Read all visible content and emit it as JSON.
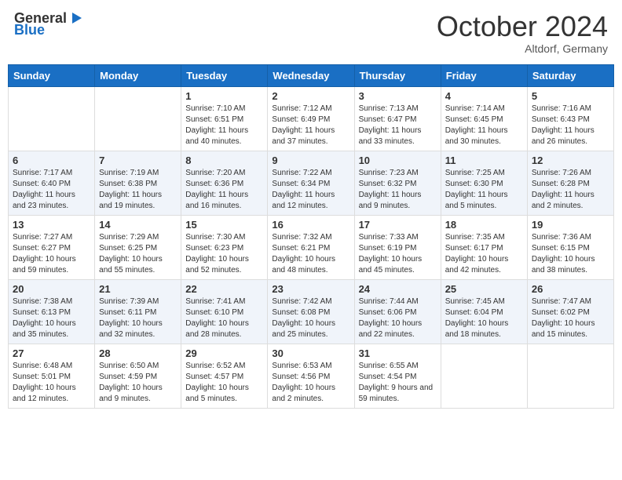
{
  "header": {
    "logo_general": "General",
    "logo_blue": "Blue",
    "month": "October 2024",
    "location": "Altdorf, Germany"
  },
  "weekdays": [
    "Sunday",
    "Monday",
    "Tuesday",
    "Wednesday",
    "Thursday",
    "Friday",
    "Saturday"
  ],
  "weeks": [
    [
      {
        "day": "",
        "sunrise": "",
        "sunset": "",
        "daylight": ""
      },
      {
        "day": "",
        "sunrise": "",
        "sunset": "",
        "daylight": ""
      },
      {
        "day": "1",
        "sunrise": "Sunrise: 7:10 AM",
        "sunset": "Sunset: 6:51 PM",
        "daylight": "Daylight: 11 hours and 40 minutes."
      },
      {
        "day": "2",
        "sunrise": "Sunrise: 7:12 AM",
        "sunset": "Sunset: 6:49 PM",
        "daylight": "Daylight: 11 hours and 37 minutes."
      },
      {
        "day": "3",
        "sunrise": "Sunrise: 7:13 AM",
        "sunset": "Sunset: 6:47 PM",
        "daylight": "Daylight: 11 hours and 33 minutes."
      },
      {
        "day": "4",
        "sunrise": "Sunrise: 7:14 AM",
        "sunset": "Sunset: 6:45 PM",
        "daylight": "Daylight: 11 hours and 30 minutes."
      },
      {
        "day": "5",
        "sunrise": "Sunrise: 7:16 AM",
        "sunset": "Sunset: 6:43 PM",
        "daylight": "Daylight: 11 hours and 26 minutes."
      }
    ],
    [
      {
        "day": "6",
        "sunrise": "Sunrise: 7:17 AM",
        "sunset": "Sunset: 6:40 PM",
        "daylight": "Daylight: 11 hours and 23 minutes."
      },
      {
        "day": "7",
        "sunrise": "Sunrise: 7:19 AM",
        "sunset": "Sunset: 6:38 PM",
        "daylight": "Daylight: 11 hours and 19 minutes."
      },
      {
        "day": "8",
        "sunrise": "Sunrise: 7:20 AM",
        "sunset": "Sunset: 6:36 PM",
        "daylight": "Daylight: 11 hours and 16 minutes."
      },
      {
        "day": "9",
        "sunrise": "Sunrise: 7:22 AM",
        "sunset": "Sunset: 6:34 PM",
        "daylight": "Daylight: 11 hours and 12 minutes."
      },
      {
        "day": "10",
        "sunrise": "Sunrise: 7:23 AM",
        "sunset": "Sunset: 6:32 PM",
        "daylight": "Daylight: 11 hours and 9 minutes."
      },
      {
        "day": "11",
        "sunrise": "Sunrise: 7:25 AM",
        "sunset": "Sunset: 6:30 PM",
        "daylight": "Daylight: 11 hours and 5 minutes."
      },
      {
        "day": "12",
        "sunrise": "Sunrise: 7:26 AM",
        "sunset": "Sunset: 6:28 PM",
        "daylight": "Daylight: 11 hours and 2 minutes."
      }
    ],
    [
      {
        "day": "13",
        "sunrise": "Sunrise: 7:27 AM",
        "sunset": "Sunset: 6:27 PM",
        "daylight": "Daylight: 10 hours and 59 minutes."
      },
      {
        "day": "14",
        "sunrise": "Sunrise: 7:29 AM",
        "sunset": "Sunset: 6:25 PM",
        "daylight": "Daylight: 10 hours and 55 minutes."
      },
      {
        "day": "15",
        "sunrise": "Sunrise: 7:30 AM",
        "sunset": "Sunset: 6:23 PM",
        "daylight": "Daylight: 10 hours and 52 minutes."
      },
      {
        "day": "16",
        "sunrise": "Sunrise: 7:32 AM",
        "sunset": "Sunset: 6:21 PM",
        "daylight": "Daylight: 10 hours and 48 minutes."
      },
      {
        "day": "17",
        "sunrise": "Sunrise: 7:33 AM",
        "sunset": "Sunset: 6:19 PM",
        "daylight": "Daylight: 10 hours and 45 minutes."
      },
      {
        "day": "18",
        "sunrise": "Sunrise: 7:35 AM",
        "sunset": "Sunset: 6:17 PM",
        "daylight": "Daylight: 10 hours and 42 minutes."
      },
      {
        "day": "19",
        "sunrise": "Sunrise: 7:36 AM",
        "sunset": "Sunset: 6:15 PM",
        "daylight": "Daylight: 10 hours and 38 minutes."
      }
    ],
    [
      {
        "day": "20",
        "sunrise": "Sunrise: 7:38 AM",
        "sunset": "Sunset: 6:13 PM",
        "daylight": "Daylight: 10 hours and 35 minutes."
      },
      {
        "day": "21",
        "sunrise": "Sunrise: 7:39 AM",
        "sunset": "Sunset: 6:11 PM",
        "daylight": "Daylight: 10 hours and 32 minutes."
      },
      {
        "day": "22",
        "sunrise": "Sunrise: 7:41 AM",
        "sunset": "Sunset: 6:10 PM",
        "daylight": "Daylight: 10 hours and 28 minutes."
      },
      {
        "day": "23",
        "sunrise": "Sunrise: 7:42 AM",
        "sunset": "Sunset: 6:08 PM",
        "daylight": "Daylight: 10 hours and 25 minutes."
      },
      {
        "day": "24",
        "sunrise": "Sunrise: 7:44 AM",
        "sunset": "Sunset: 6:06 PM",
        "daylight": "Daylight: 10 hours and 22 minutes."
      },
      {
        "day": "25",
        "sunrise": "Sunrise: 7:45 AM",
        "sunset": "Sunset: 6:04 PM",
        "daylight": "Daylight: 10 hours and 18 minutes."
      },
      {
        "day": "26",
        "sunrise": "Sunrise: 7:47 AM",
        "sunset": "Sunset: 6:02 PM",
        "daylight": "Daylight: 10 hours and 15 minutes."
      }
    ],
    [
      {
        "day": "27",
        "sunrise": "Sunrise: 6:48 AM",
        "sunset": "Sunset: 5:01 PM",
        "daylight": "Daylight: 10 hours and 12 minutes."
      },
      {
        "day": "28",
        "sunrise": "Sunrise: 6:50 AM",
        "sunset": "Sunset: 4:59 PM",
        "daylight": "Daylight: 10 hours and 9 minutes."
      },
      {
        "day": "29",
        "sunrise": "Sunrise: 6:52 AM",
        "sunset": "Sunset: 4:57 PM",
        "daylight": "Daylight: 10 hours and 5 minutes."
      },
      {
        "day": "30",
        "sunrise": "Sunrise: 6:53 AM",
        "sunset": "Sunset: 4:56 PM",
        "daylight": "Daylight: 10 hours and 2 minutes."
      },
      {
        "day": "31",
        "sunrise": "Sunrise: 6:55 AM",
        "sunset": "Sunset: 4:54 PM",
        "daylight": "Daylight: 9 hours and 59 minutes."
      },
      {
        "day": "",
        "sunrise": "",
        "sunset": "",
        "daylight": ""
      },
      {
        "day": "",
        "sunrise": "",
        "sunset": "",
        "daylight": ""
      }
    ]
  ]
}
